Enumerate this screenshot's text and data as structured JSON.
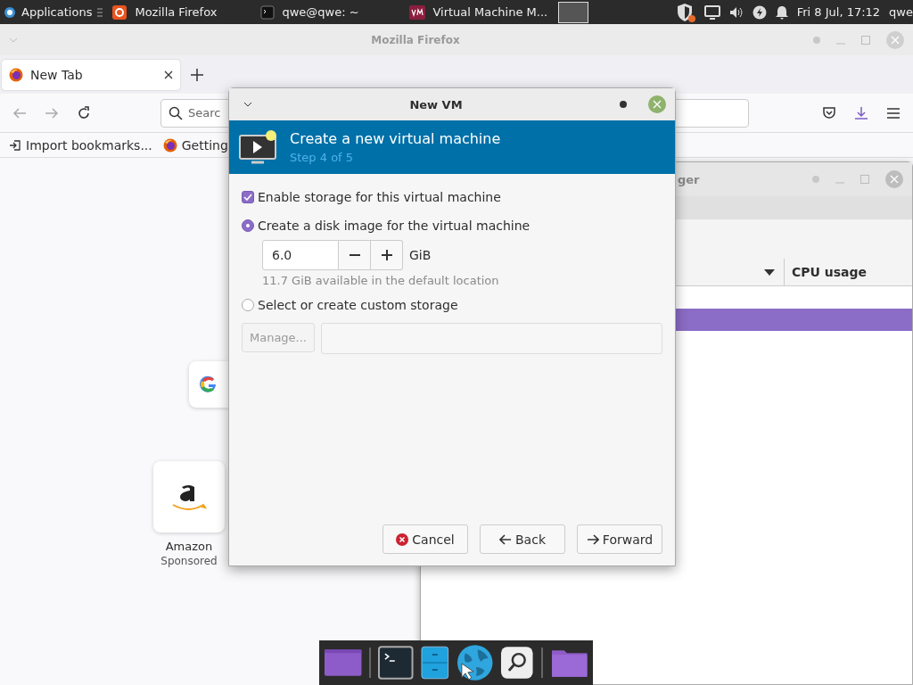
{
  "top_panel": {
    "apps_menu": "Applications",
    "tasks": [
      {
        "title": "Mozilla Firefox",
        "kind": "firefox"
      },
      {
        "title": "qwe@qwe: ~",
        "kind": "terminal"
      },
      {
        "title": "Virtual Machine M...",
        "kind": "vmm"
      }
    ],
    "clock": "Fri  8 Jul, 17:12",
    "user": "qwe"
  },
  "firefox": {
    "title": "Mozilla Firefox",
    "tab": {
      "label": "New Tab"
    },
    "search_placeholder": "Searc",
    "bookmarks": [
      {
        "label": "Import bookmarks...",
        "kind": "import"
      },
      {
        "label": "Getting",
        "kind": "firefox"
      }
    ],
    "shortcuts": [
      {
        "label": "Amazon",
        "sublabel": "Sponsored"
      }
    ]
  },
  "vmm": {
    "title": "ger",
    "columns": [
      "CPU usage"
    ],
    "rows": [
      {
        "selected": false
      },
      {
        "selected": true
      }
    ]
  },
  "dialog": {
    "title": "New VM",
    "heading": "Create a new virtual machine",
    "step": "Step 4 of 5",
    "enable_storage": {
      "label": "Enable storage for this virtual machine",
      "checked": true
    },
    "options": [
      {
        "label": "Create a disk image for the virtual machine",
        "selected": true
      },
      {
        "label": "Select or create custom storage",
        "selected": false
      }
    ],
    "size": {
      "value": "6.0",
      "unit": "GiB"
    },
    "available": "11.7 GiB available in the default location",
    "manage": {
      "label": "Manage...",
      "disabled": true
    },
    "buttons": [
      {
        "label": "Cancel",
        "kind": "cancel"
      },
      {
        "label": "Back",
        "kind": "back"
      },
      {
        "label": "Forward",
        "kind": "forward"
      }
    ]
  },
  "dock": {
    "items": [
      {
        "kind": "window"
      },
      {
        "kind": "separator"
      },
      {
        "kind": "terminal"
      },
      {
        "kind": "files"
      },
      {
        "kind": "browser"
      },
      {
        "kind": "search"
      },
      {
        "kind": "separator"
      },
      {
        "kind": "folder"
      }
    ]
  }
}
